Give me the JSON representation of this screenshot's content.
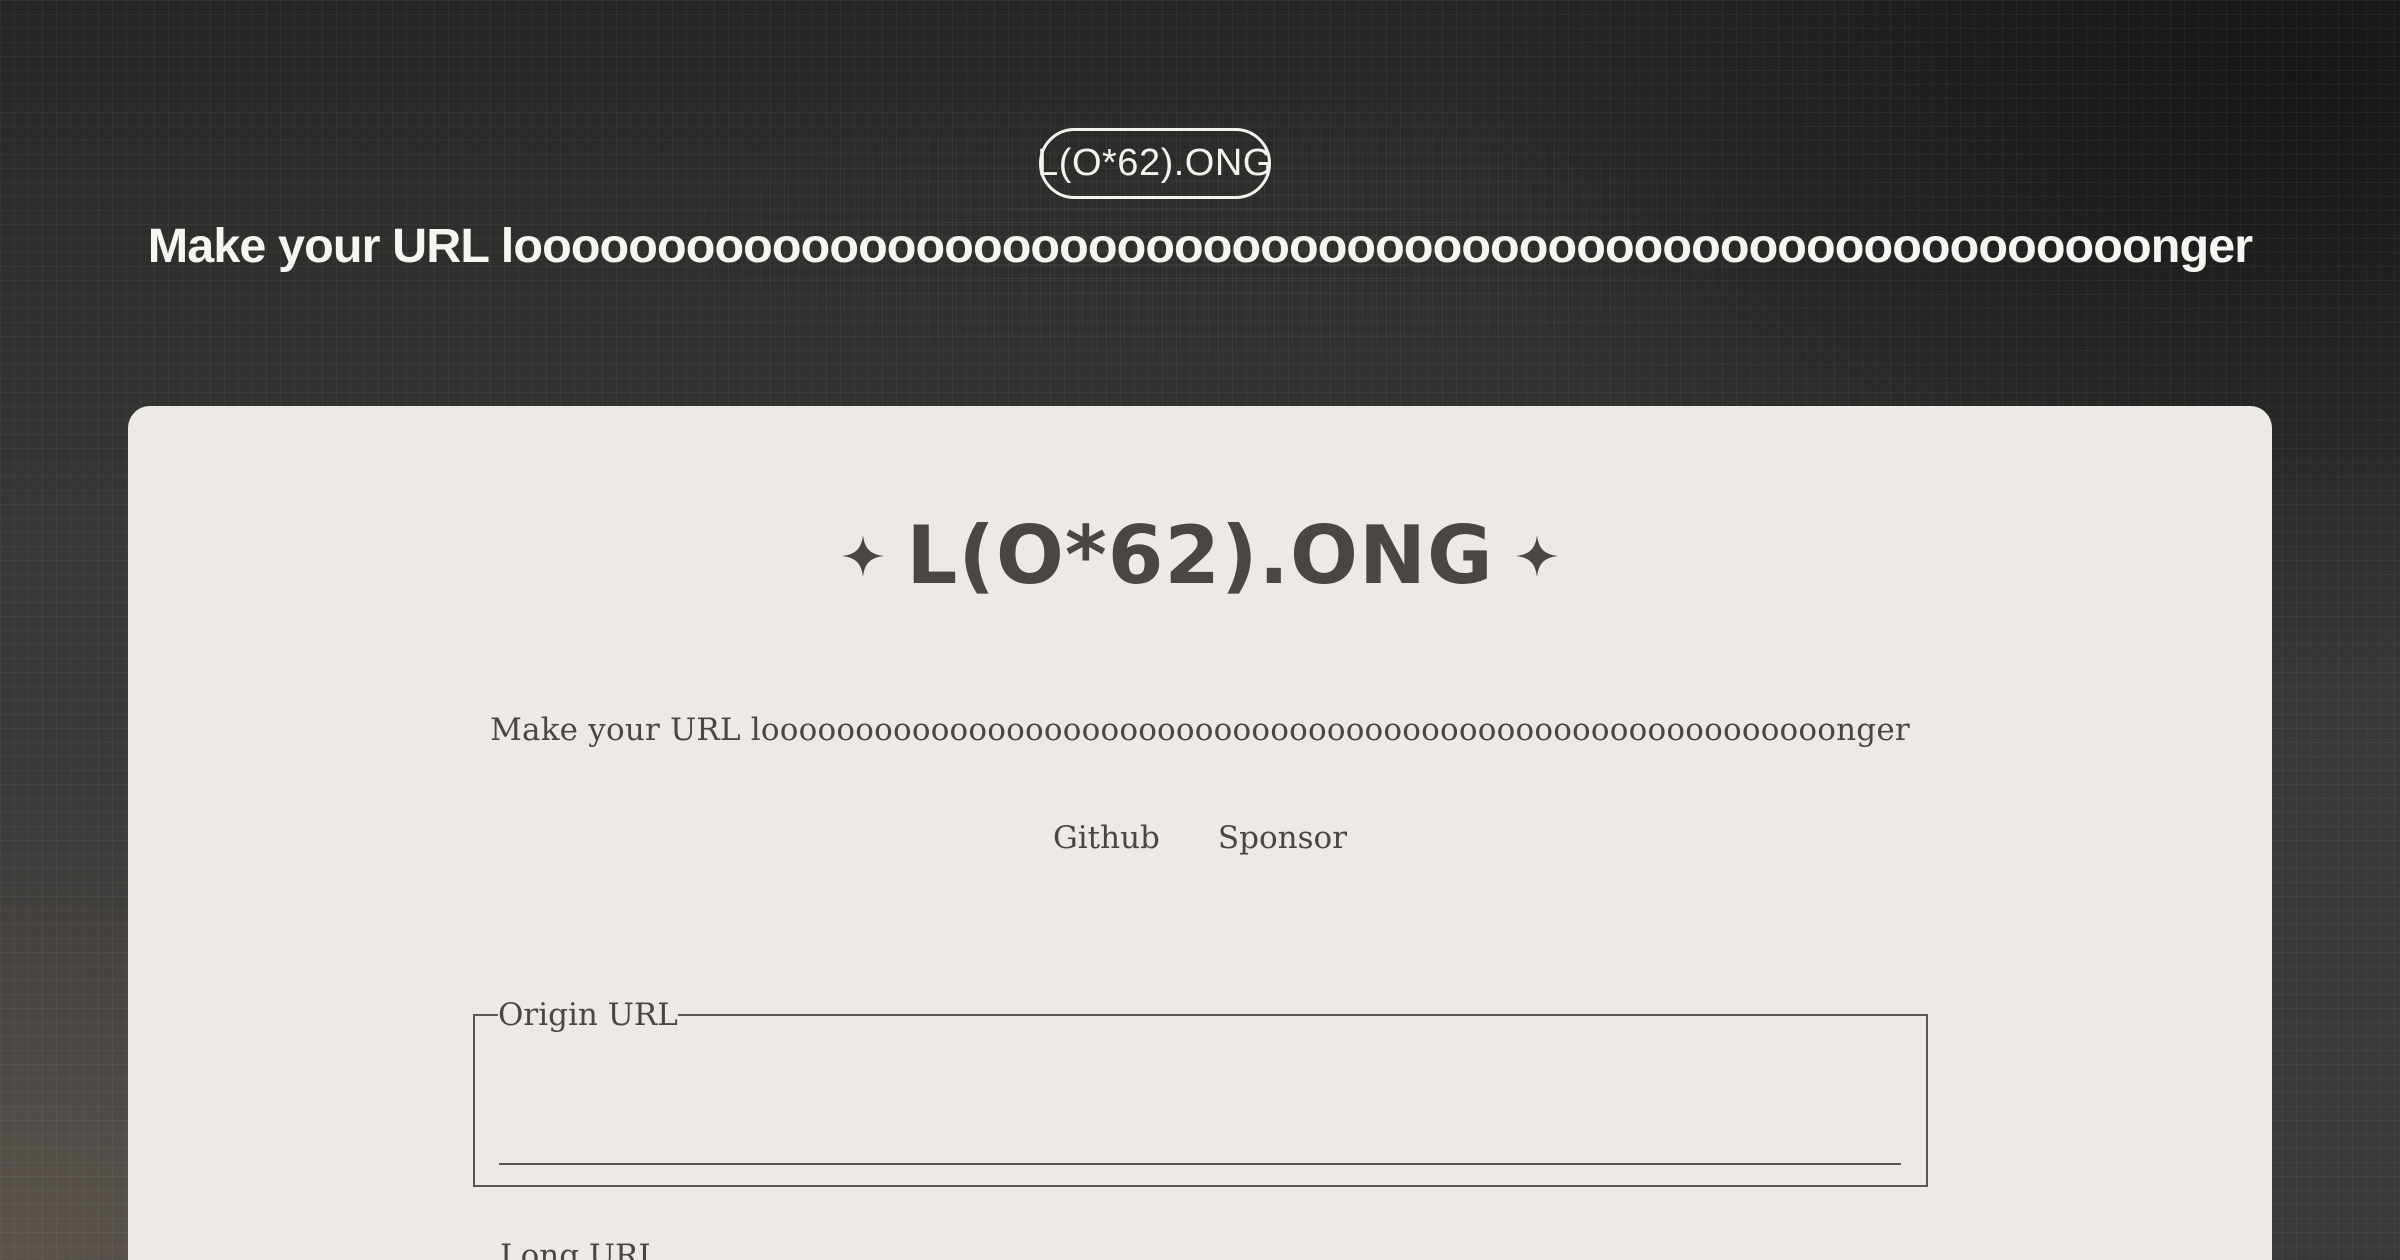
{
  "badge": {
    "label": "L(O*62).ONG"
  },
  "hero": {
    "title": "Make your URL looooooooooooooooooooooooooooooooooooooooooooooooooooooooonger"
  },
  "card": {
    "logo_text": "L(O*62).ONG",
    "subtitle": "Make your URL looooooooooooooooooooooooooooooooooooooooooooooooooooooooonger",
    "links": [
      {
        "label": "Github"
      },
      {
        "label": "Sponsor"
      }
    ],
    "origin_field": {
      "legend": "Origin URL",
      "value": "",
      "placeholder": ""
    },
    "long_url_label": "Long URL"
  },
  "colors": {
    "card_background": "#edeae5",
    "card_text": "#4a4644",
    "hero_text": "#f7f5f1",
    "page_background": "#383837"
  }
}
